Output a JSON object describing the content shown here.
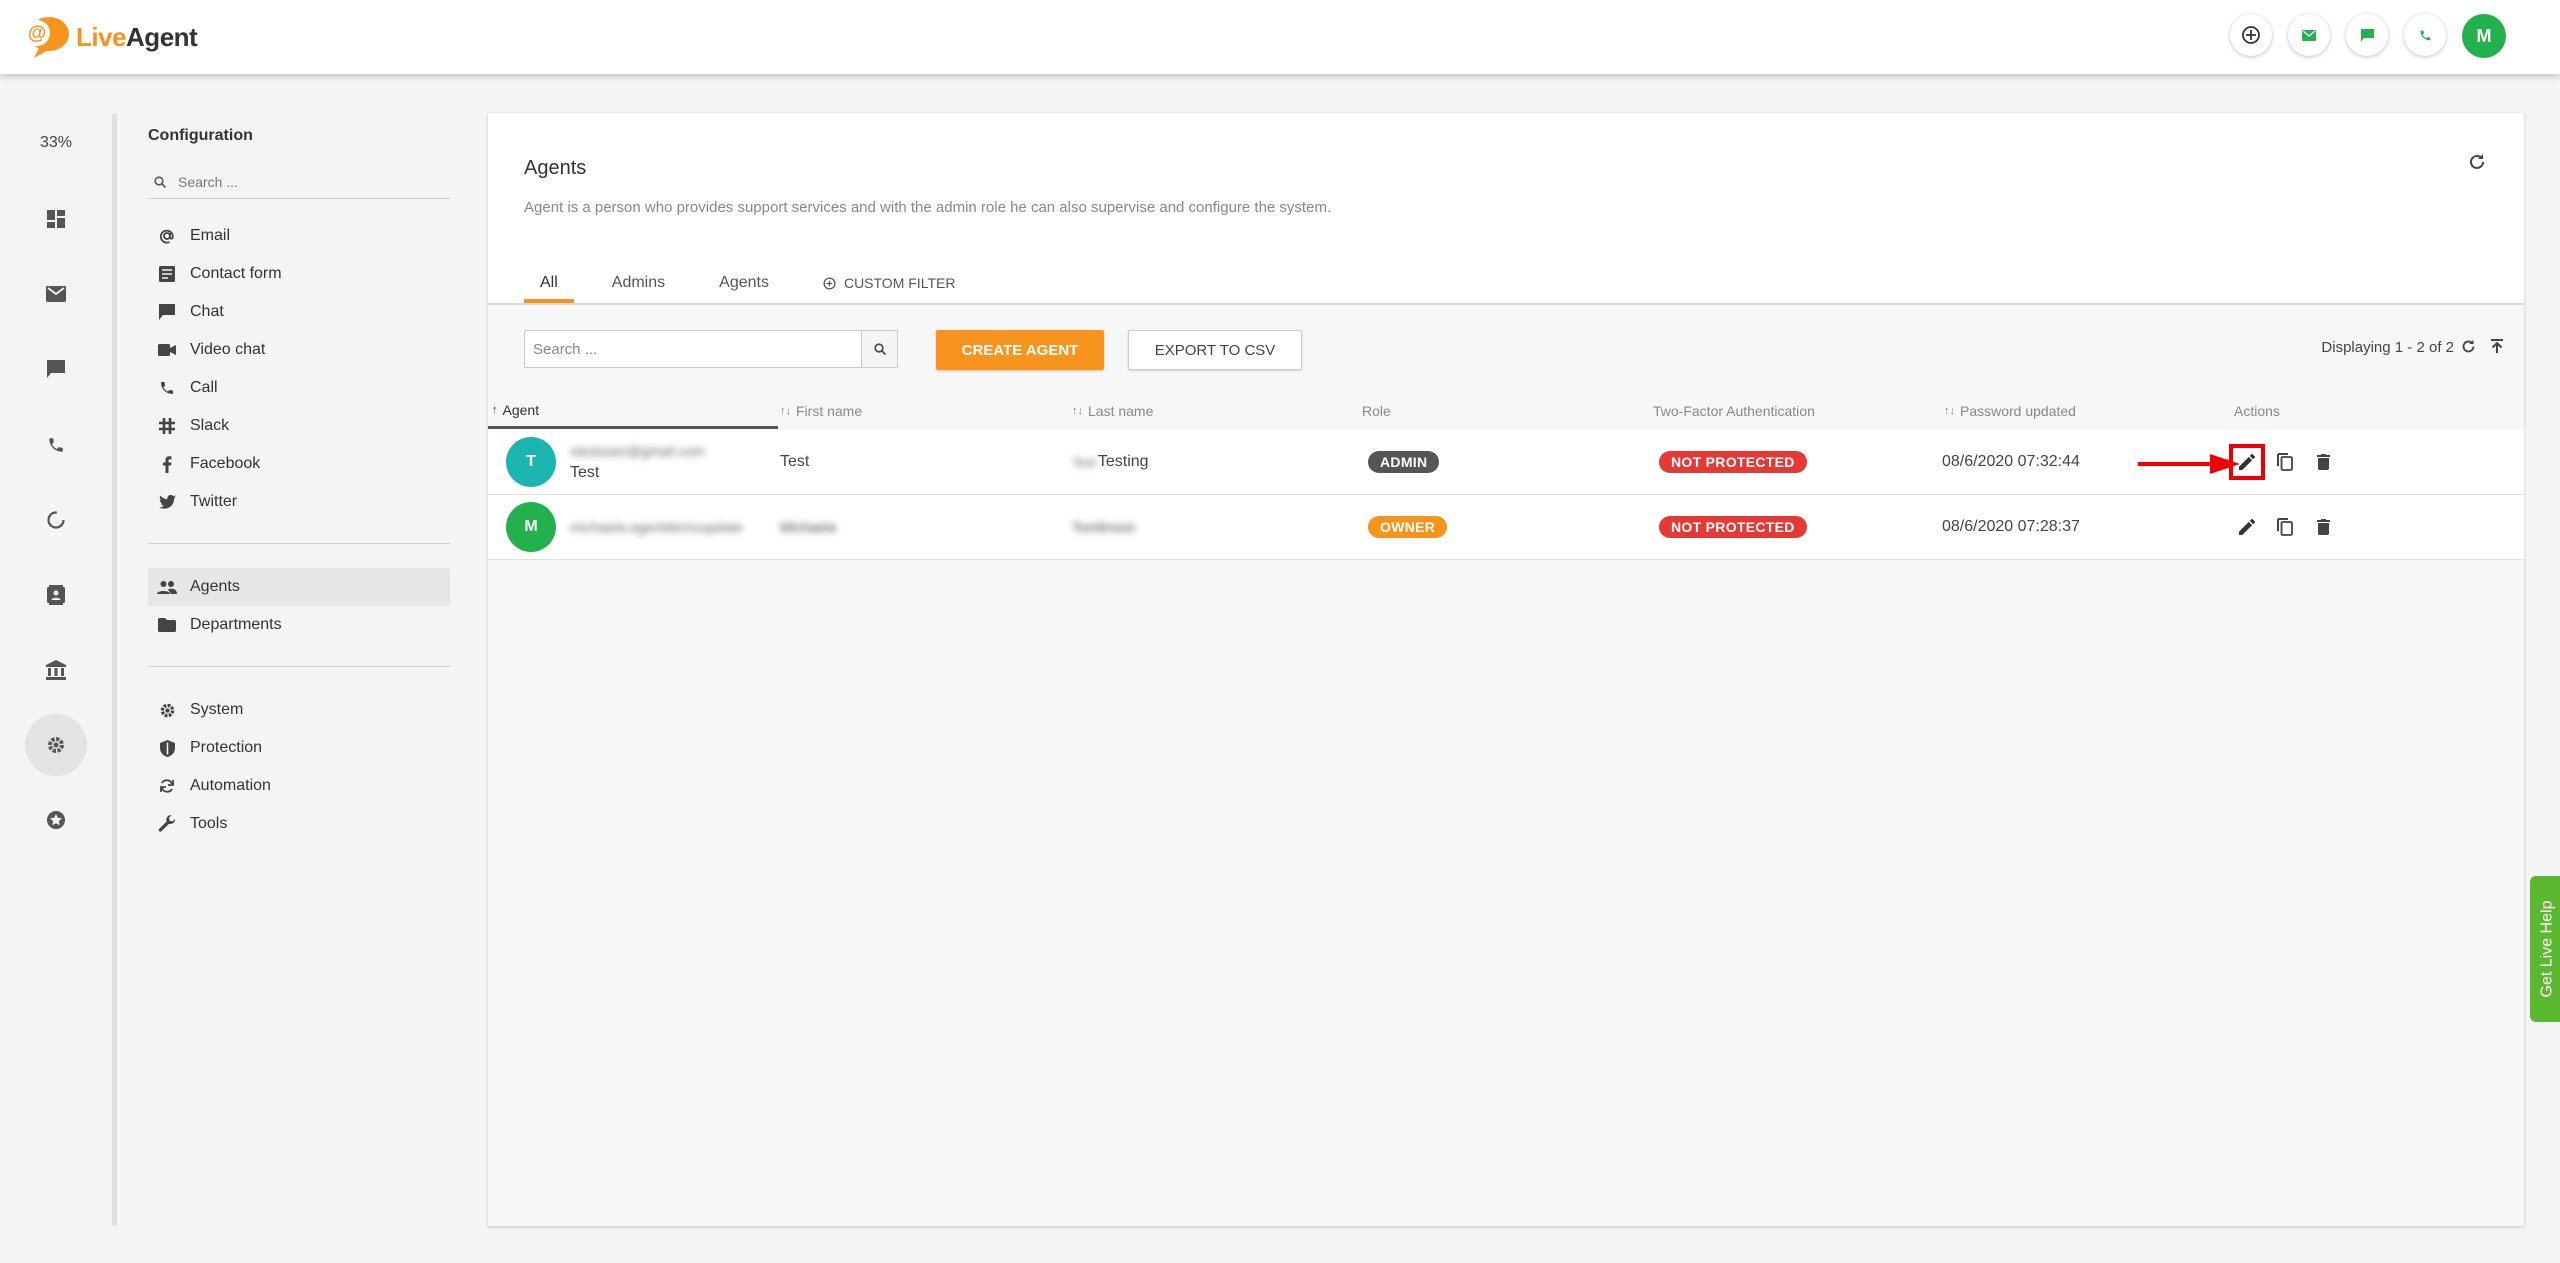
{
  "app": {
    "logo_live": "Live",
    "logo_agent": "Agent"
  },
  "topbar": {
    "avatar_initial": "M",
    "icons": [
      "add-circle-icon",
      "email-icon",
      "chat-icon",
      "phone-icon"
    ]
  },
  "rail": {
    "percent": "33%",
    "items": [
      "dashboard-icon",
      "email-icon",
      "chat-icon",
      "phone-icon",
      "reports-icon",
      "contacts-icon",
      "knowledgebase-icon",
      "settings-icon",
      "premium-icon"
    ]
  },
  "config": {
    "title": "Configuration",
    "search_placeholder": "Search ...",
    "group1": [
      "Email",
      "Contact form",
      "Chat",
      "Video chat",
      "Call",
      "Slack",
      "Facebook",
      "Twitter"
    ],
    "group2": [
      "Agents",
      "Departments"
    ],
    "group3": [
      "System",
      "Protection",
      "Automation",
      "Tools"
    ]
  },
  "page": {
    "title": "Agents",
    "description": "Agent is a person who provides support services and with the admin role he can also supervise and configure the system.",
    "tabs": [
      "All",
      "Admins",
      "Agents"
    ],
    "custom_filter": "CUSTOM FILTER"
  },
  "toolbar": {
    "search_placeholder": "Search ...",
    "create_label": "CREATE AGENT",
    "export_label": "EXPORT TO CSV",
    "displaying": "Displaying 1 - 2 of 2"
  },
  "table": {
    "headers": {
      "agent": "Agent",
      "first_name": "First name",
      "last_name": "Last name",
      "role": "Role",
      "two_factor": "Two-Factor Authentication",
      "password_updated": "Password updated",
      "actions": "Actions"
    },
    "rows": [
      {
        "initial": "T",
        "avatar_color": "#1bb5b0",
        "email": "xtestuser@gmail.com",
        "name": "Test",
        "first_name": "Test",
        "last_name_prefix": "Test",
        "last_name": "Testing",
        "role": "ADMIN",
        "role_color": "#555555",
        "two_factor": "NOT PROTECTED",
        "two_factor_color": "#e53935",
        "password_updated": "08/6/2020 07:32:44"
      },
      {
        "initial": "M",
        "avatar_color": "#22b14c",
        "email": "michaela.agentdemoupdate",
        "name": "",
        "first_name": "Michaela",
        "last_name_prefix": "",
        "last_name": "Tomlinson",
        "role": "OWNER",
        "role_color": "#f7941d",
        "two_factor": "NOT PROTECTED",
        "two_factor_color": "#e53935",
        "password_updated": "08/6/2020 07:28:37"
      }
    ]
  },
  "live_help": "Get Live Help"
}
